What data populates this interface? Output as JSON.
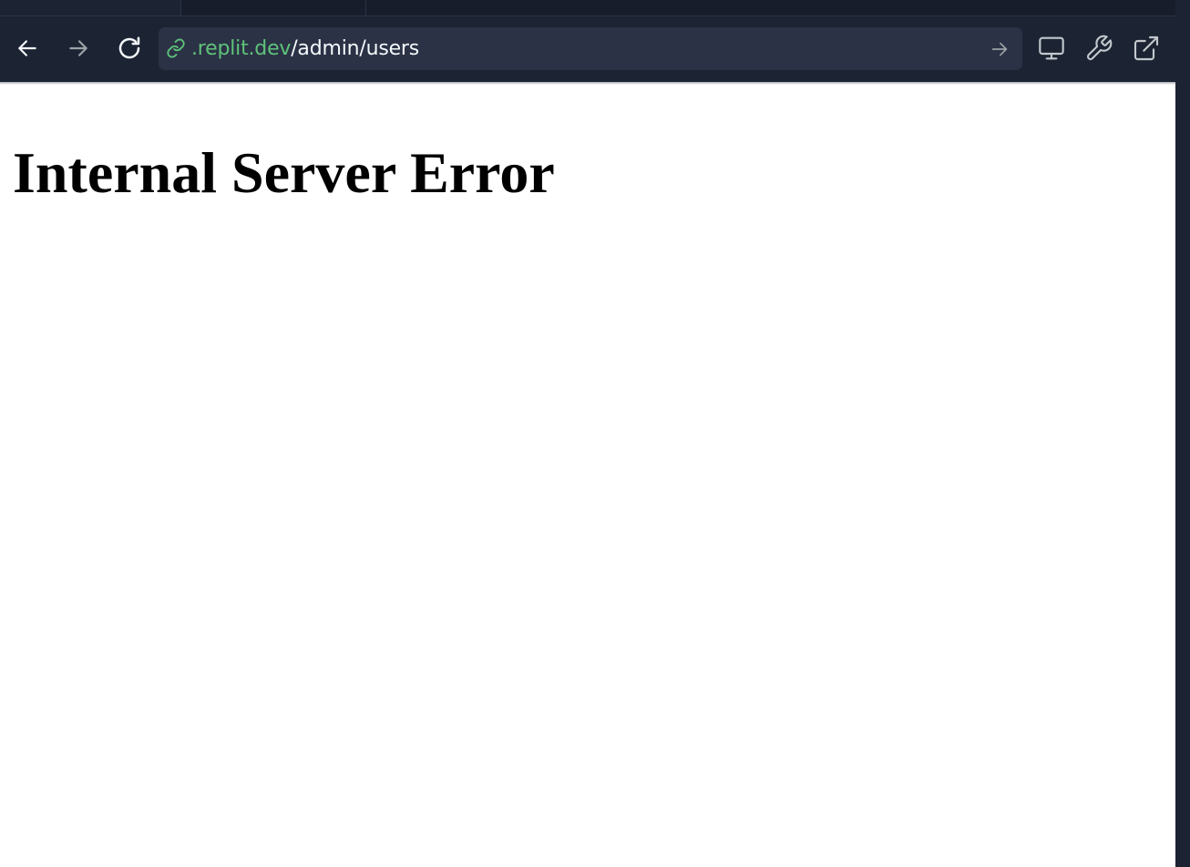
{
  "browser": {
    "url": {
      "domain": ".replit.dev",
      "path": "/admin/users"
    },
    "icons": {
      "back": "arrow-left-icon",
      "forward": "arrow-right-icon",
      "reload": "reload-icon",
      "link": "link-icon",
      "go": "arrow-right-icon",
      "devices": "monitor-icon",
      "devtools": "wrench-icon",
      "new_tab": "external-link-icon"
    },
    "colors": {
      "chrome_bg": "#1c2333",
      "url_bar_bg": "#2b3245",
      "domain_text": "#5fc27a",
      "path_text": "#f5f9fc"
    }
  },
  "page": {
    "heading": "Internal Server Error"
  }
}
